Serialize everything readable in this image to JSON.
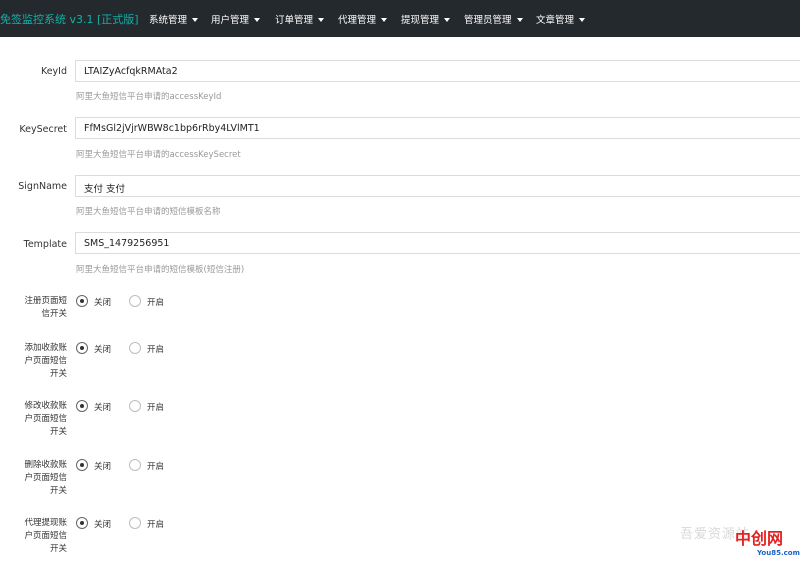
{
  "header": {
    "brand": "免签监控系统 v3.1 [正式版]",
    "menus": [
      {
        "label": "系统管理"
      },
      {
        "label": "用户管理"
      },
      {
        "label": "订单管理"
      },
      {
        "label": "代理管理"
      },
      {
        "label": "提现管理"
      },
      {
        "label": "管理员管理"
      },
      {
        "label": "文章管理"
      }
    ]
  },
  "form": {
    "fields": [
      {
        "label": "KeyId",
        "value": "LTAIZyAcfqkRMAta2",
        "help": "阿里大鱼短信平台申请的accessKeyId"
      },
      {
        "label": "KeySecret",
        "value": "FfMsGl2jVjrWBW8c1bp6rRby4LVlMT1",
        "help": "阿里大鱼短信平台申请的accessKeySecret"
      },
      {
        "label": "SignName",
        "value": "支付 支付",
        "help": "阿里大鱼短信平台申请的短信模板名称"
      },
      {
        "label": "Template",
        "value": "SMS_1479256951",
        "help": "阿里大鱼短信平台申请的短信模板(短信注册)"
      }
    ],
    "switches": [
      {
        "lines": [
          "注册页面短",
          "信开关"
        ],
        "off_label": "关闭",
        "on_label": "开启",
        "selected": "off"
      },
      {
        "lines": [
          "添加收款账",
          "户页面短信",
          "开关"
        ],
        "off_label": "关闭",
        "on_label": "开启",
        "selected": "off"
      },
      {
        "lines": [
          "修改收款账",
          "户页面短信",
          "开关"
        ],
        "off_label": "关闭",
        "on_label": "开启",
        "selected": "off"
      },
      {
        "lines": [
          "删除收款账",
          "户页面短信",
          "开关"
        ],
        "off_label": "关闭",
        "on_label": "开启",
        "selected": "off"
      },
      {
        "lines": [
          "代理提现账",
          "户页面短信",
          "开关"
        ],
        "off_label": "关闭",
        "on_label": "开启",
        "selected": "off"
      }
    ]
  },
  "watermark": {
    "left_text": "吾爱资源站",
    "logo_text": "中创网",
    "site": "You85.com"
  }
}
